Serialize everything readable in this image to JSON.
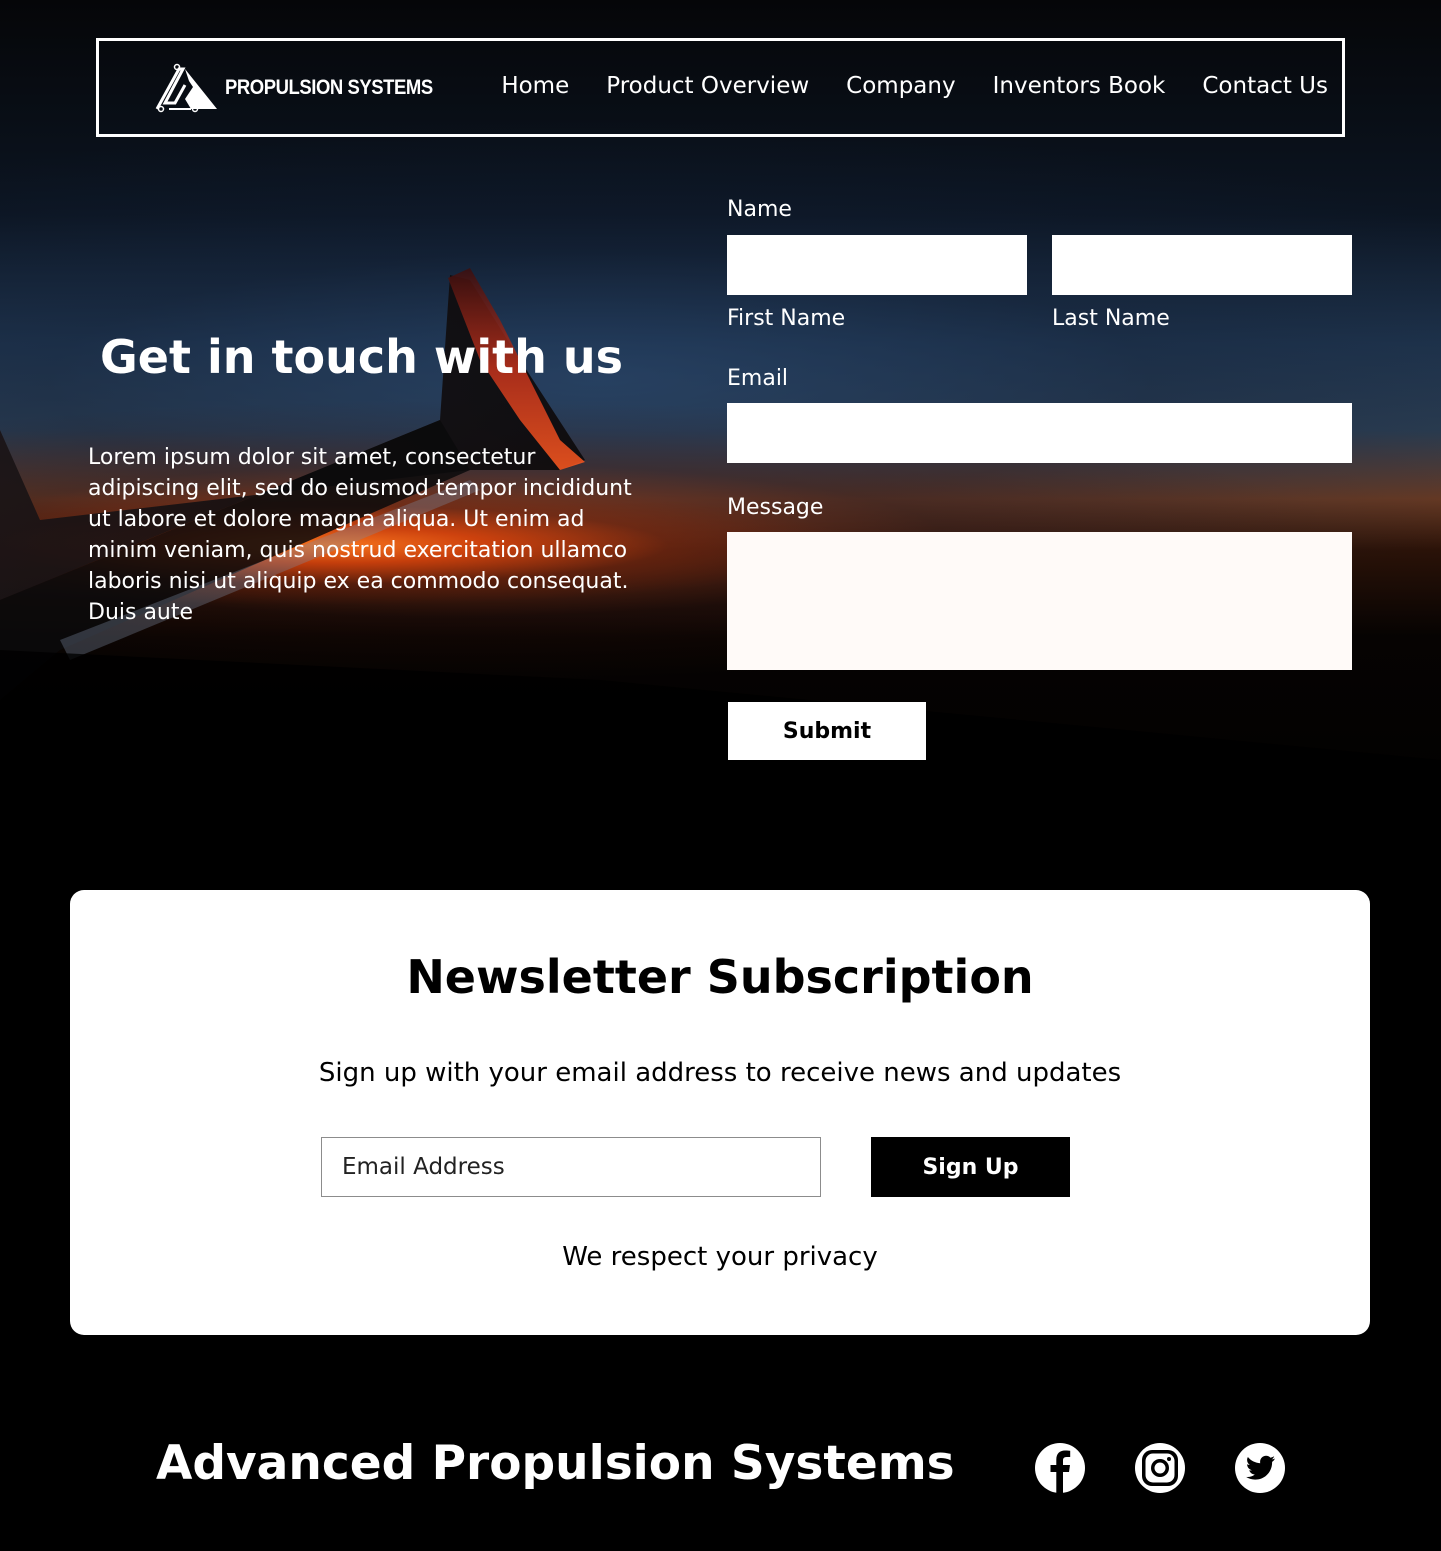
{
  "brand": {
    "logo_text": "PROPULSION SYSTEMS"
  },
  "nav": {
    "items": [
      "Home",
      "Product Overview",
      "Company",
      "Inventors Book",
      "Contact Us"
    ]
  },
  "hero": {
    "title": "Get in touch with us",
    "body": "Lorem ipsum dolor sit amet, consectetur adipiscing elit, sed do eiusmod tempor incididunt ut labore et dolore magna aliqua. Ut enim ad minim veniam, quis nostrud exercitation ullamco laboris nisi ut aliquip ex ea commodo consequat. Duis aute"
  },
  "form": {
    "name_label": "Name",
    "first_name_label": "First Name",
    "last_name_label": "Last Name",
    "email_label": "Email",
    "message_label": "Message",
    "first_name_value": "",
    "last_name_value": "",
    "email_value": "",
    "message_value": "",
    "submit_label": "Submit"
  },
  "newsletter": {
    "title": "Newsletter Subscription",
    "subtitle": "Sign up with your email address to receive news and updates",
    "email_placeholder": "Email Address",
    "signup_label": "Sign Up",
    "privacy_text": "We respect your privacy"
  },
  "footer": {
    "company_name": "Advanced Propulsion Systems",
    "social_icons": [
      "facebook-icon",
      "instagram-icon",
      "twitter-icon"
    ]
  },
  "colors": {
    "background": "#000000",
    "card": "#ffffff",
    "accent_sunset": "#ff6a1a"
  }
}
